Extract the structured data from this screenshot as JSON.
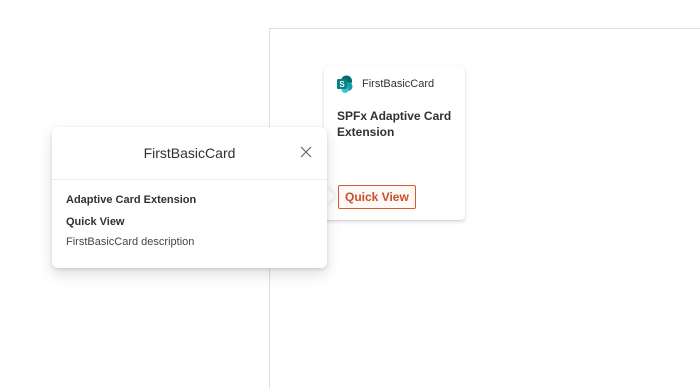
{
  "card": {
    "app_name": "FirstBasicCard",
    "title": "SPFx Adaptive Card Extension",
    "button_label": "Quick View",
    "icon": "sharepoint-logo-icon"
  },
  "callout": {
    "title": "FirstBasicCard",
    "heading": "Adaptive Card Extension",
    "subheading": "Quick View",
    "description": "FirstBasicCard description",
    "close_icon": "close-icon"
  },
  "colors": {
    "accent": "#c5522b",
    "sharepoint_teal": "#038387",
    "border": "#e1dfdd"
  }
}
